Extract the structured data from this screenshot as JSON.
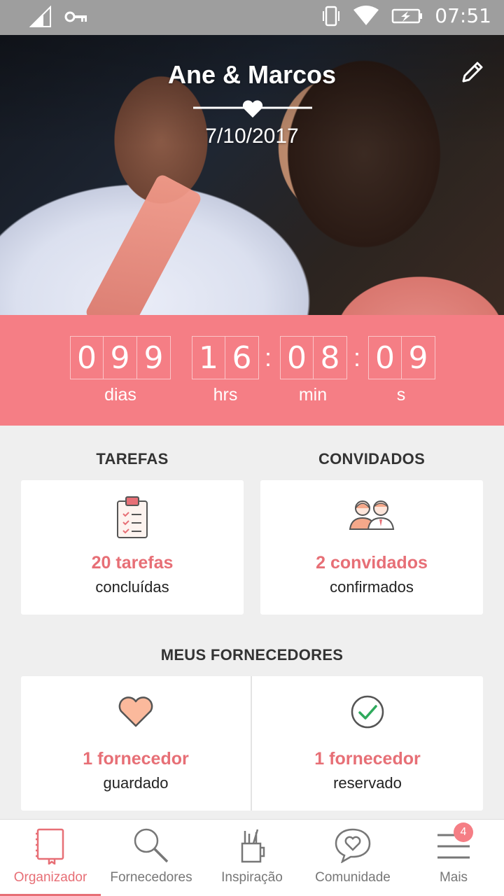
{
  "status_bar": {
    "time": "07:51"
  },
  "hero": {
    "title": "Ane & Marcos",
    "date": "7/10/2017"
  },
  "countdown": {
    "days": [
      "0",
      "9",
      "9"
    ],
    "hours": [
      "1",
      "6"
    ],
    "minutes": [
      "0",
      "8"
    ],
    "seconds": [
      "0",
      "9"
    ],
    "labels": {
      "days": "dias",
      "hours": "hrs",
      "minutes": "min",
      "seconds": "s"
    }
  },
  "tasks": {
    "heading": "TAREFAS",
    "value": "20 tarefas",
    "sub": "concluídas"
  },
  "guests": {
    "heading": "CONVIDADOS",
    "value": "2 convidados",
    "sub": "confirmados"
  },
  "vendors": {
    "heading": "MEUS FORNECEDORES",
    "saved": {
      "value": "1 fornecedor",
      "sub": "guardado"
    },
    "booked": {
      "value": "1 fornecedor",
      "sub": "reservado"
    }
  },
  "nav": {
    "items": [
      {
        "label": "Organizador",
        "icon": "notebook-icon"
      },
      {
        "label": "Fornecedores",
        "icon": "search-icon"
      },
      {
        "label": "Inspiração",
        "icon": "pencil-cup-icon"
      },
      {
        "label": "Comunidade",
        "icon": "chat-heart-icon"
      },
      {
        "label": "Mais",
        "icon": "menu-icon"
      }
    ],
    "badge": "4"
  },
  "colors": {
    "accent": "#f57e85",
    "accent_text": "#e76f76",
    "status_bar": "#9e9e9e"
  }
}
